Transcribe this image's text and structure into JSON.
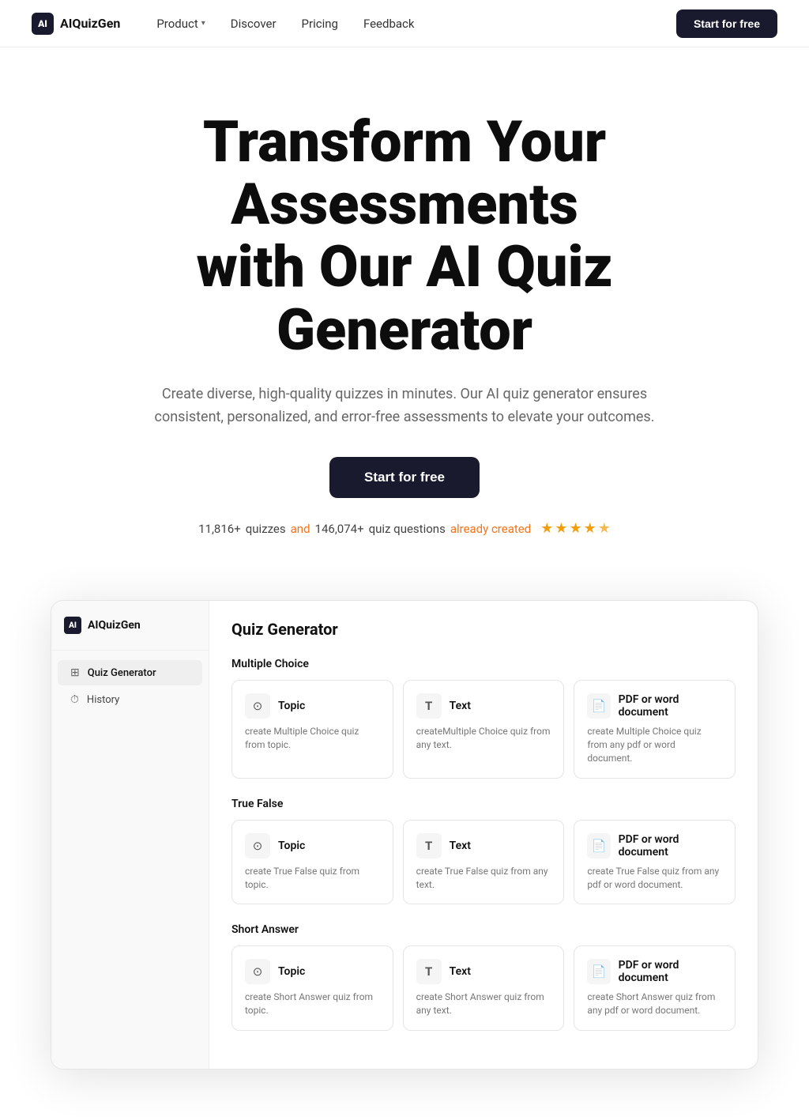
{
  "brand": {
    "name": "AIQuizGen",
    "logo_text": "AI"
  },
  "nav": {
    "links": [
      {
        "id": "product",
        "label": "Product",
        "has_dropdown": true
      },
      {
        "id": "discover",
        "label": "Discover",
        "has_dropdown": false
      },
      {
        "id": "pricing",
        "label": "Pricing",
        "has_dropdown": false
      },
      {
        "id": "feedback",
        "label": "Feedback",
        "has_dropdown": false
      }
    ],
    "cta_label": "Start for free"
  },
  "hero": {
    "heading_line1": "Transform Your Assessments",
    "heading_line2": "with Our AI Quiz Generator",
    "subheading": "Create diverse, high-quality quizzes in minutes. Our AI quiz generator ensures consistent, personalized, and error-free assessments to elevate your outcomes.",
    "cta_label": "Start for free",
    "stats": {
      "quizzes_count": "11,816+",
      "quizzes_label": "quizzes",
      "connector": "and",
      "questions_count": "146,074+",
      "questions_label": "quiz questions",
      "suffix": "already created"
    },
    "rating": {
      "filled": 4,
      "half": true
    }
  },
  "app_preview": {
    "sidebar": {
      "logo": "AIQuizGen",
      "items": [
        {
          "id": "quiz-generator",
          "label": "Quiz Generator",
          "icon": "⊞",
          "active": true
        },
        {
          "id": "history",
          "label": "History",
          "icon": "⏱",
          "active": false
        }
      ]
    },
    "main": {
      "title": "Quiz Generator",
      "sections": [
        {
          "id": "multiple-choice",
          "label": "Multiple Choice",
          "cards": [
            {
              "id": "mc-topic",
              "icon": "⊙",
              "title": "Topic",
              "desc": "create Multiple Choice quiz from topic."
            },
            {
              "id": "mc-text",
              "icon": "T",
              "title": "Text",
              "desc": "createMultiple Choice quiz from any text."
            },
            {
              "id": "mc-pdf",
              "icon": "📄",
              "title": "PDF or word document",
              "desc": "create Multiple Choice quiz from any pdf or word document."
            }
          ]
        },
        {
          "id": "true-false",
          "label": "True False",
          "cards": [
            {
              "id": "tf-topic",
              "icon": "⊙",
              "title": "Topic",
              "desc": "create True False quiz from topic."
            },
            {
              "id": "tf-text",
              "icon": "T",
              "title": "Text",
              "desc": "create True False quiz from any text."
            },
            {
              "id": "tf-pdf",
              "icon": "📄",
              "title": "PDF or word document",
              "desc": "create True False quiz from any pdf or word document."
            }
          ]
        },
        {
          "id": "short-answer",
          "label": "Short Answer",
          "cards": [
            {
              "id": "sa-topic",
              "icon": "⊙",
              "title": "Topic",
              "desc": "create Short Answer quiz from topic."
            },
            {
              "id": "sa-text",
              "icon": "T",
              "title": "Text",
              "desc": "create Short Answer quiz from any text."
            },
            {
              "id": "sa-pdf",
              "icon": "📄",
              "title": "PDF or word document",
              "desc": "create Short Answer quiz from any pdf or word document."
            }
          ]
        }
      ]
    }
  }
}
